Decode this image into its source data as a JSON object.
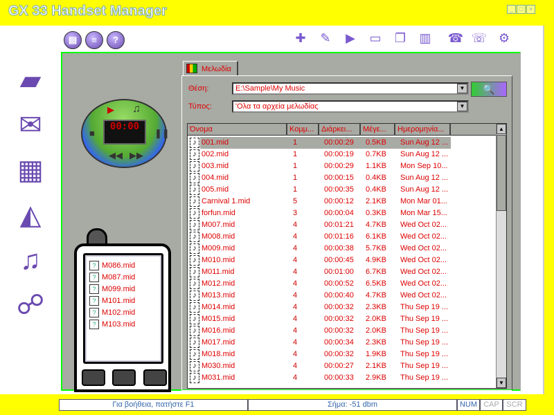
{
  "window": {
    "title": "GX 33 Handset Manager",
    "controls": [
      "minimize",
      "maximize",
      "close"
    ]
  },
  "toolbar_left": [
    {
      "icon": "document-icon",
      "glyph": "▤"
    },
    {
      "icon": "list-icon",
      "glyph": "≡"
    },
    {
      "icon": "help-icon",
      "glyph": "?"
    }
  ],
  "toolbar_right": [
    {
      "icon": "new-icon",
      "glyph": "✚"
    },
    {
      "icon": "edit-icon",
      "glyph": "✎"
    },
    {
      "icon": "play-icon",
      "glyph": "▶"
    },
    {
      "icon": "folder-icon",
      "glyph": "▭"
    },
    {
      "icon": "copy-icon",
      "glyph": "❐"
    },
    {
      "icon": "book-icon",
      "glyph": "▥"
    },
    {
      "icon": "phone-download-icon",
      "glyph": "☎"
    },
    {
      "icon": "phone-upload-icon",
      "glyph": "☏"
    },
    {
      "icon": "settings-icon",
      "glyph": "⚙"
    }
  ],
  "sidebar": [
    {
      "icon": "device-icon",
      "glyph": "▰"
    },
    {
      "icon": "message-icon",
      "glyph": "✉"
    },
    {
      "icon": "phonebook-icon",
      "glyph": "▦"
    },
    {
      "icon": "calendar-icon",
      "glyph": "◭"
    },
    {
      "icon": "melody-icon",
      "glyph": "♫"
    },
    {
      "icon": "connection-icon",
      "glyph": "☍"
    }
  ],
  "tab": {
    "label": "Μελωδία"
  },
  "location": {
    "label": "Θέση:",
    "value": "E:\\Sample\\My Music"
  },
  "type": {
    "label": "Τύπος:",
    "value": "'Ολα τα αρχεία μελωδίας"
  },
  "player": {
    "display": "00:00"
  },
  "columns": [
    "Όνομα",
    "Κομμ...",
    "Διάρκει...",
    "Μέγε...",
    "Ημερομηνία..."
  ],
  "files": [
    {
      "name": "001.mid",
      "k": "1",
      "dur": "00:00:29",
      "size": "0.5KB",
      "date": "Sun Aug 12 ...",
      "selected": true
    },
    {
      "name": "002.mid",
      "k": "1",
      "dur": "00:00:19",
      "size": "0.7KB",
      "date": "Sun Aug 12 ..."
    },
    {
      "name": "003.mid",
      "k": "1",
      "dur": "00:00:29",
      "size": "1.1KB",
      "date": "Mon Sep 10..."
    },
    {
      "name": "004.mid",
      "k": "1",
      "dur": "00:00:15",
      "size": "0.4KB",
      "date": "Sun Aug 12 ..."
    },
    {
      "name": "005.mid",
      "k": "1",
      "dur": "00:00:35",
      "size": "0.4KB",
      "date": "Sun Aug 12 ..."
    },
    {
      "name": "Carnival 1.mid",
      "k": "5",
      "dur": "00:00:12",
      "size": "2.1KB",
      "date": "Mon Mar 01..."
    },
    {
      "name": "forfun.mid",
      "k": "3",
      "dur": "00:00:04",
      "size": "0.3KB",
      "date": "Mon Mar 15..."
    },
    {
      "name": "M007.mid",
      "k": "4",
      "dur": "00:01:21",
      "size": "4.7KB",
      "date": "Wed Oct 02..."
    },
    {
      "name": "M008.mid",
      "k": "4",
      "dur": "00:01:16",
      "size": "6.1KB",
      "date": "Wed Oct 02..."
    },
    {
      "name": "M009.mid",
      "k": "4",
      "dur": "00:00:38",
      "size": "5.7KB",
      "date": "Wed Oct 02..."
    },
    {
      "name": "M010.mid",
      "k": "4",
      "dur": "00:00:45",
      "size": "4.9KB",
      "date": "Wed Oct 02..."
    },
    {
      "name": "M011.mid",
      "k": "4",
      "dur": "00:01:00",
      "size": "6.7KB",
      "date": "Wed Oct 02..."
    },
    {
      "name": "M012.mid",
      "k": "4",
      "dur": "00:00:52",
      "size": "6.5KB",
      "date": "Wed Oct 02..."
    },
    {
      "name": "M013.mid",
      "k": "4",
      "dur": "00:00:40",
      "size": "4.7KB",
      "date": "Wed Oct 02..."
    },
    {
      "name": "M014.mid",
      "k": "4",
      "dur": "00:00:32",
      "size": "2.3KB",
      "date": "Thu Sep 19 ..."
    },
    {
      "name": "M015.mid",
      "k": "4",
      "dur": "00:00:32",
      "size": "2.0KB",
      "date": "Thu Sep 19 ..."
    },
    {
      "name": "M016.mid",
      "k": "4",
      "dur": "00:00:32",
      "size": "2.0KB",
      "date": "Thu Sep 19 ..."
    },
    {
      "name": "M017.mid",
      "k": "4",
      "dur": "00:00:34",
      "size": "2.3KB",
      "date": "Thu Sep 19 ..."
    },
    {
      "name": "M018.mid",
      "k": "4",
      "dur": "00:00:32",
      "size": "1.9KB",
      "date": "Thu Sep 19 ..."
    },
    {
      "name": "M030.mid",
      "k": "4",
      "dur": "00:00:27",
      "size": "2.1KB",
      "date": "Thu Sep 19 ..."
    },
    {
      "name": "M031.mid",
      "k": "4",
      "dur": "00:00:33",
      "size": "2.9KB",
      "date": "Thu Sep 19 ..."
    }
  ],
  "phone_files": [
    "M086.mid",
    "M087.mid",
    "M099.mid",
    "M101.mid",
    "M102.mid",
    "M103.mid"
  ],
  "status": {
    "help": "Για βοήθεια, πατήστε F1",
    "signal": "Σήμα: -51 dbm",
    "num": "NUM",
    "cap": "CAP",
    "scr": "SCR"
  },
  "colors": {
    "background": "#ffff00",
    "panel": "#a8aaa4",
    "text_accent": "#dd0000"
  }
}
